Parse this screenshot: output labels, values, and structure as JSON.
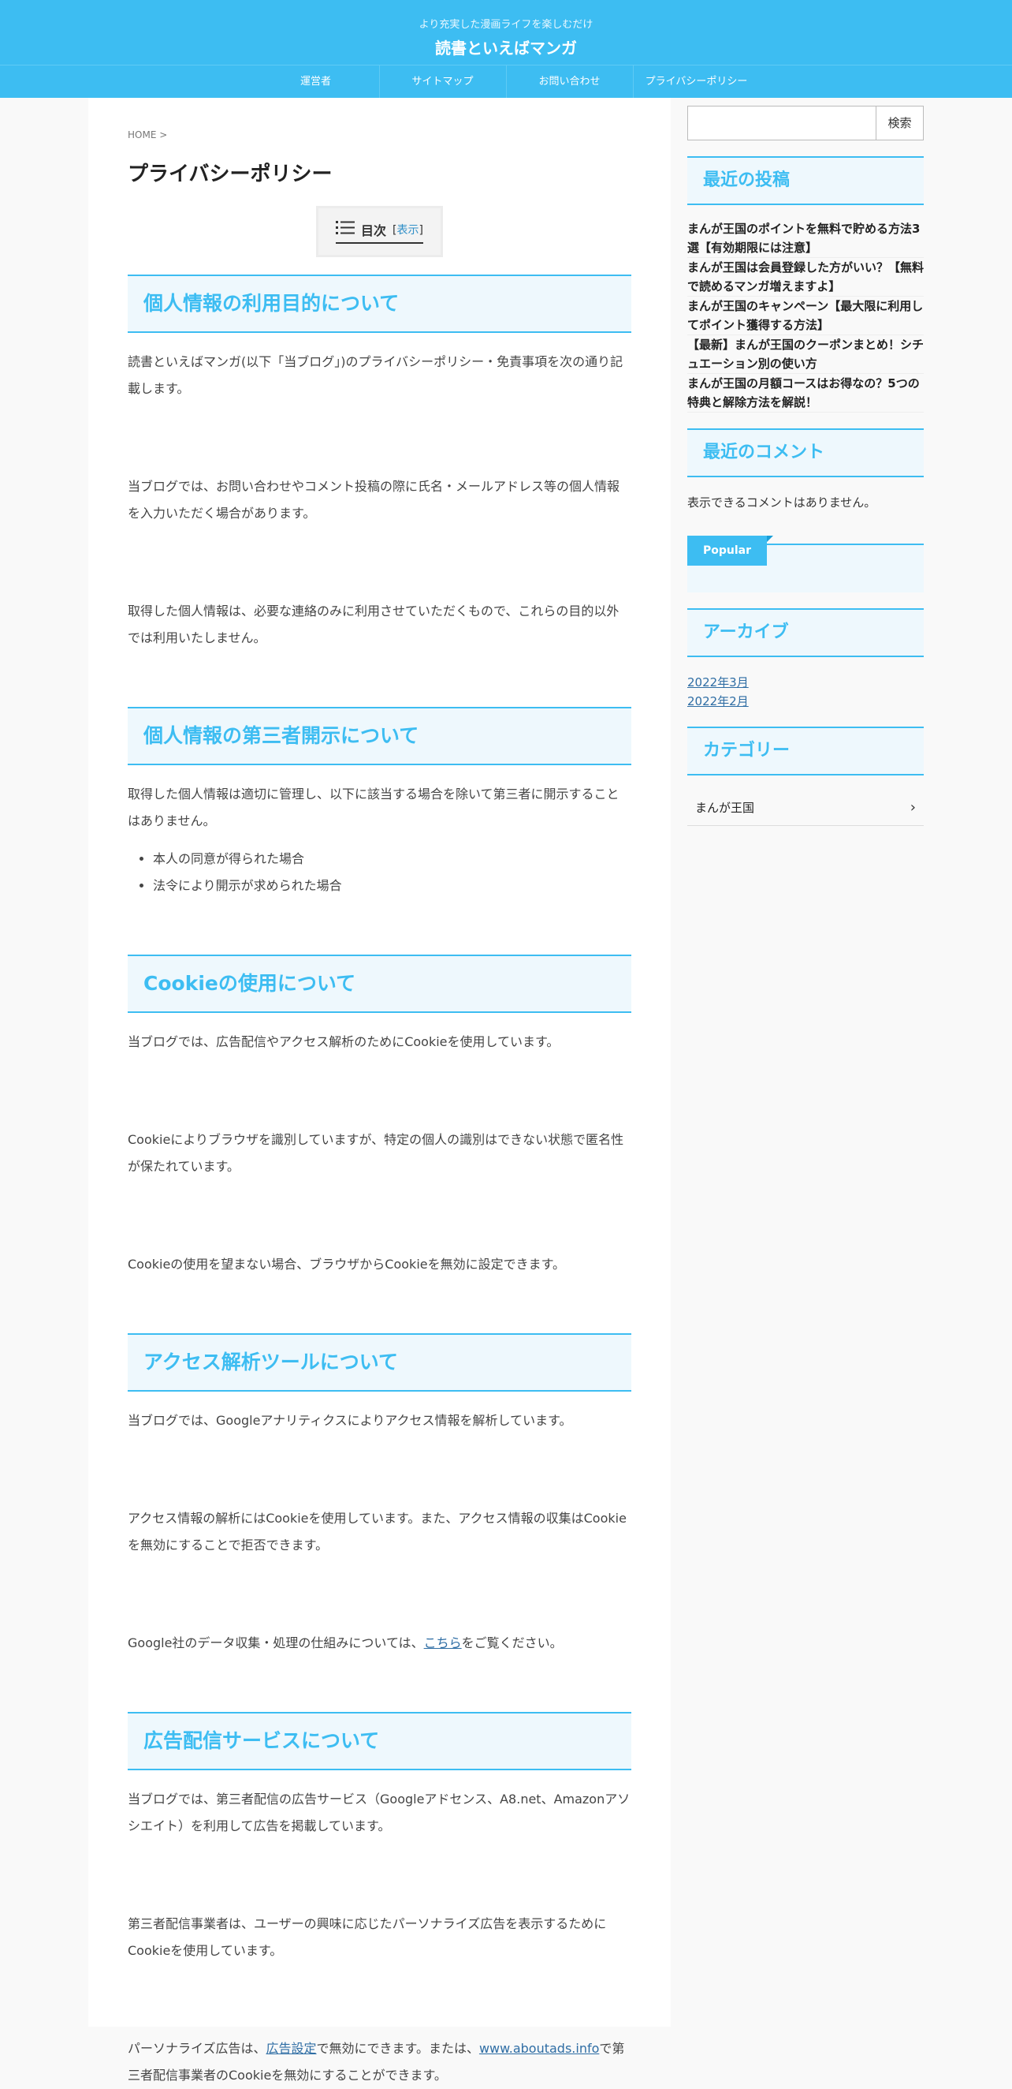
{
  "header": {
    "tagline": "より充実した漫画ライフを楽しむだけ",
    "site_title": "読書といえばマンガ",
    "accent_color": "#3dbdf2"
  },
  "nav": [
    "運営者",
    "サイトマップ",
    "お問い合わせ",
    "プライバシーポリシー"
  ],
  "breadcrumb": "HOME >",
  "page_title": "プライバシーポリシー",
  "toc": {
    "title": "目次",
    "toggle_open": "[",
    "toggle_link": "表示",
    "toggle_close": "]",
    "icon": "list-icon"
  },
  "sections": [
    {
      "heading": "個人情報の利用目的について",
      "paras": [
        "読書といえばマンガ(以下「当ブログ」)のプライバシーポリシー・免責事項を次の通り記載します。",
        "当ブログでは、お問い合わせやコメント投稿の際に氏名・メールアドレス等の個人情報を入力いただく場合があります。",
        "取得した個人情報は、必要な連絡のみに利用させていただくもので、これらの目的以外では利用いたしません。"
      ]
    },
    {
      "heading": "個人情報の第三者開示について",
      "paras": [
        "取得した個人情報は適切に管理し、以下に該当する場合を除いて第三者に開示することはありません。"
      ],
      "list": [
        "本人の同意が得られた場合",
        "法令により開示が求められた場合"
      ]
    },
    {
      "heading": "Cookieの使用について",
      "paras": [
        "当ブログでは、広告配信やアクセス解析のためにCookieを使用しています。",
        "Cookieによりブラウザを識別していますが、特定の個人の識別はできない状態で匿名性が保たれています。",
        "Cookieの使用を望まない場合、ブラウザからCookieを無効に設定できます。"
      ]
    },
    {
      "heading": "アクセス解析ツールについて",
      "paras": [
        "当ブログでは、Googleアナリティクスによりアクセス情報を解析しています。",
        "アクセス情報の解析にはCookieを使用しています。また、アクセス情報の収集はCookieを無効にすることで拒否できます。"
      ],
      "link_para": {
        "before": "Google社のデータ収集・処理の仕組みについては、",
        "link": "こちら",
        "after": "をご覧ください。"
      }
    },
    {
      "heading": "広告配信サービスについて",
      "paras": [
        "当ブログでは、第三者配信の広告サービス（Googleアドセンス、A8.net、Amazonアソシエイト）を利用して広告を掲載しています。",
        "第三者配信事業者は、ユーザーの興味に応じたパーソナライズ広告を表示するためにCookieを使用しています。"
      ],
      "link_para": {
        "before": "パーソナライズ広告は、",
        "link": "広告設定",
        "middle": "で無効にできます。または、",
        "link2": "www.aboutads.info",
        "after": "で第三者配信事業者のCookieを無効にすることができます。"
      }
    }
  ],
  "sidebar": {
    "search_button": "検索",
    "recent_posts_title": "最近の投稿",
    "recent_posts": [
      "まんが王国のポイントを無料で貯める方法3選【有効期限には注意】",
      "まんが王国は会員登録した方がいい？【無料で読めるマンガ増えますよ】",
      "まんが王国のキャンペーン【最大限に利用してポイント獲得する方法】",
      "【最新】まんが王国のクーポンまとめ！シチュエーション別の使い方",
      "まんが王国の月額コースはお得なの？5つの特典と解除方法を解説！"
    ],
    "recent_comments_title": "最近のコメント",
    "no_comments": "表示できるコメントはありません。",
    "popular_tab": "Popular",
    "archive_title": "アーカイブ",
    "archives": [
      "2022年3月",
      "2022年2月"
    ],
    "category_title": "カテゴリー",
    "category": "まんが王国"
  }
}
